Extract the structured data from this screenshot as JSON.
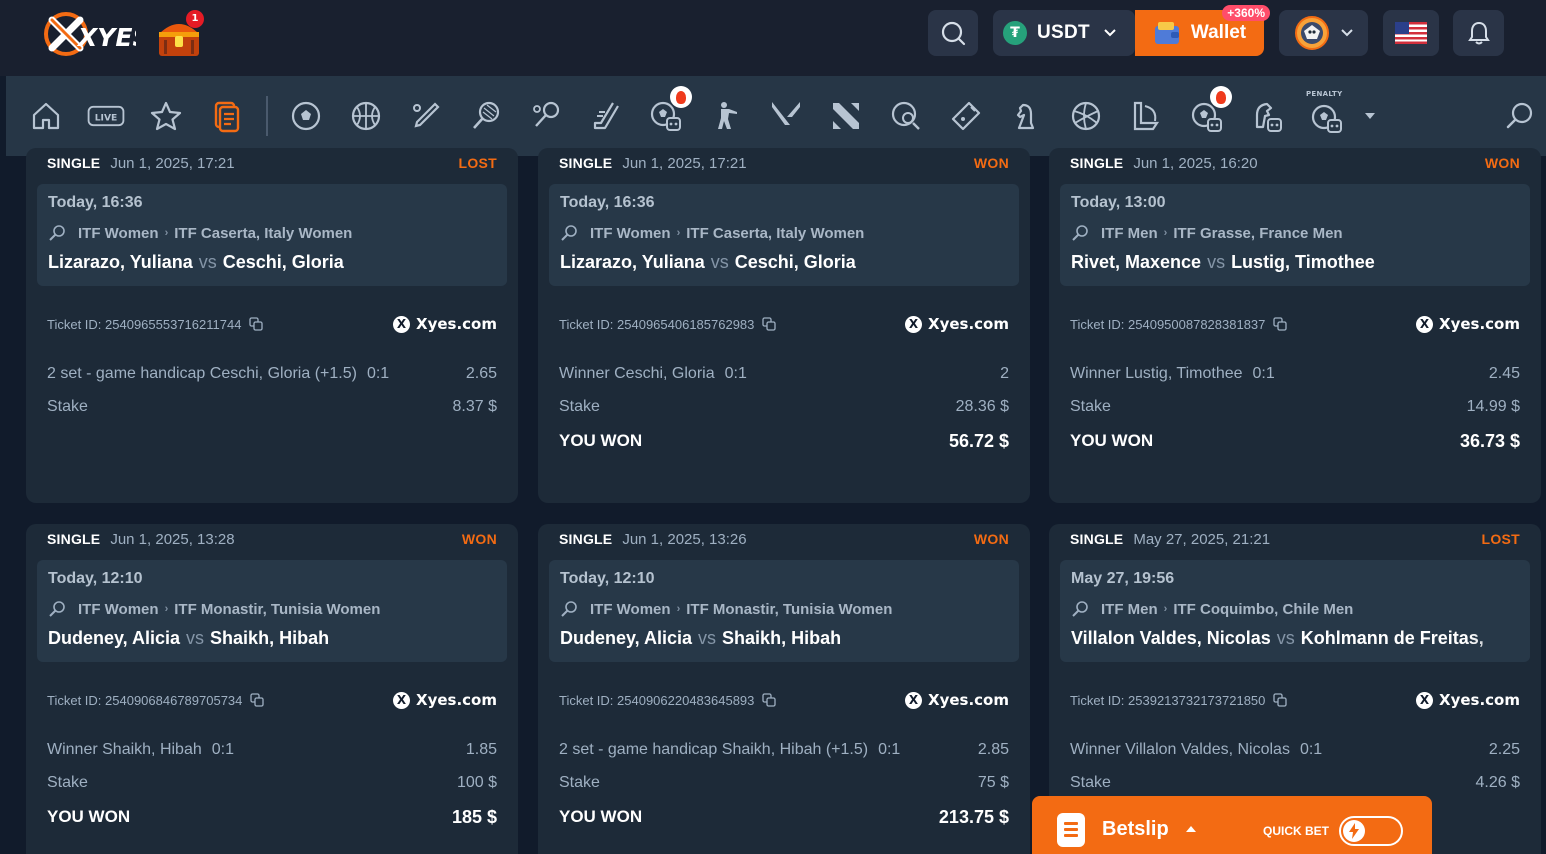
{
  "header": {
    "logo_text": "XYES",
    "chest_badge": "1",
    "currency": {
      "code": "USDT",
      "icon": "tether-icon"
    },
    "wallet": {
      "label": "Wallet",
      "badge": "+360%"
    },
    "icons": [
      "search-icon",
      "chevron-down-icon",
      "wallet-icon",
      "avatar",
      "us-flag-icon",
      "bell-icon"
    ]
  },
  "sport_nav": {
    "items": [
      "home-icon",
      "live-icon",
      "favorites-star-icon",
      "my-bets-icon",
      "soccer-icon",
      "basketball-icon",
      "cricket-icon",
      "tennis-icon",
      "badminton-icon",
      "hockey-icon",
      "virtual-soccer-icon",
      "counter-strike-icon",
      "valorant-icon",
      "dota2-icon",
      "table-tennis-icon",
      "esports-icon",
      "chess-icon",
      "volleyball-icon",
      "league-of-legends-icon",
      "virtual-football-icon",
      "horse-racing-icon",
      "penalty-icon",
      "search-icon"
    ],
    "live_label": "LIVE",
    "penalty_label": "PENALTY",
    "accent_color": "#f36b13"
  },
  "tickets": [
    {
      "type": "SINGLE",
      "date": "Jun 1, 2025, 17:21",
      "status": "LOST",
      "event_time": "Today, 16:36",
      "league": "ITF Women",
      "tournament": "ITF Caserta, Italy Women",
      "home": "Lizarazo, Yuliana",
      "vs": "vs",
      "away": "Ceschi, Gloria",
      "ticket_id": "Ticket ID: 2540965553716211744",
      "brand": "Xyes.com",
      "selection": "2 set - game handicap Ceschi, Gloria (+1.5)",
      "score": "0:1",
      "odds": "2.65",
      "stake_label": "Stake",
      "stake": "8.37 $",
      "result_label": "",
      "result_amount": ""
    },
    {
      "type": "SINGLE",
      "date": "Jun 1, 2025, 17:21",
      "status": "WON",
      "event_time": "Today, 16:36",
      "league": "ITF Women",
      "tournament": "ITF Caserta, Italy Women",
      "home": "Lizarazo, Yuliana",
      "vs": "vs",
      "away": "Ceschi, Gloria",
      "ticket_id": "Ticket ID: 2540965406185762983",
      "brand": "Xyes.com",
      "selection": "Winner Ceschi, Gloria",
      "score": "0:1",
      "odds": "2",
      "stake_label": "Stake",
      "stake": "28.36 $",
      "result_label": "YOU WON",
      "result_amount": "56.72 $"
    },
    {
      "type": "SINGLE",
      "date": "Jun 1, 2025, 16:20",
      "status": "WON",
      "event_time": "Today, 13:00",
      "league": "ITF Men",
      "tournament": "ITF Grasse, France Men",
      "home": "Rivet, Maxence",
      "vs": "vs",
      "away": "Lustig, Timothee",
      "ticket_id": "Ticket ID: 2540950087828381837",
      "brand": "Xyes.com",
      "selection": "Winner Lustig, Timothee",
      "score": "0:1",
      "odds": "2.45",
      "stake_label": "Stake",
      "stake": "14.99 $",
      "result_label": "YOU WON",
      "result_amount": "36.73 $"
    },
    {
      "type": "SINGLE",
      "date": "Jun 1, 2025, 13:28",
      "status": "WON",
      "event_time": "Today, 12:10",
      "league": "ITF Women",
      "tournament": "ITF Monastir, Tunisia Women",
      "home": "Dudeney, Alicia",
      "vs": "vs",
      "away": "Shaikh, Hibah",
      "ticket_id": "Ticket ID: 2540906846789705734",
      "brand": "Xyes.com",
      "selection": "Winner Shaikh, Hibah",
      "score": "0:1",
      "odds": "1.85",
      "stake_label": "Stake",
      "stake": "100 $",
      "result_label": "YOU WON",
      "result_amount": "185 $"
    },
    {
      "type": "SINGLE",
      "date": "Jun 1, 2025, 13:26",
      "status": "WON",
      "event_time": "Today, 12:10",
      "league": "ITF Women",
      "tournament": "ITF Monastir, Tunisia Women",
      "home": "Dudeney, Alicia",
      "vs": "vs",
      "away": "Shaikh, Hibah",
      "ticket_id": "Ticket ID: 2540906220483645893",
      "brand": "Xyes.com",
      "selection": "2 set - game handicap Shaikh, Hibah (+1.5)",
      "score": "0:1",
      "odds": "2.85",
      "stake_label": "Stake",
      "stake": "75 $",
      "result_label": "YOU WON",
      "result_amount": "213.75 $"
    },
    {
      "type": "SINGLE",
      "date": "May 27, 2025, 21:21",
      "status": "LOST",
      "event_time": "May 27, 19:56",
      "league": "ITF Men",
      "tournament": "ITF Coquimbo, Chile Men",
      "home": "Villalon Valdes, Nicolas",
      "vs": "vs",
      "away": "Kohlmann de Freitas,",
      "ticket_id": "Ticket ID: 2539213732173721850",
      "brand": "Xyes.com",
      "selection": "Winner Villalon Valdes, Nicolas",
      "score": "0:1",
      "odds": "2.25",
      "stake_label": "Stake",
      "stake": "4.26 $",
      "result_label": "",
      "result_amount": ""
    }
  ],
  "betslip": {
    "label": "Betslip",
    "quick_bet_label": "QUICK BET",
    "quick_bet_on": false
  }
}
